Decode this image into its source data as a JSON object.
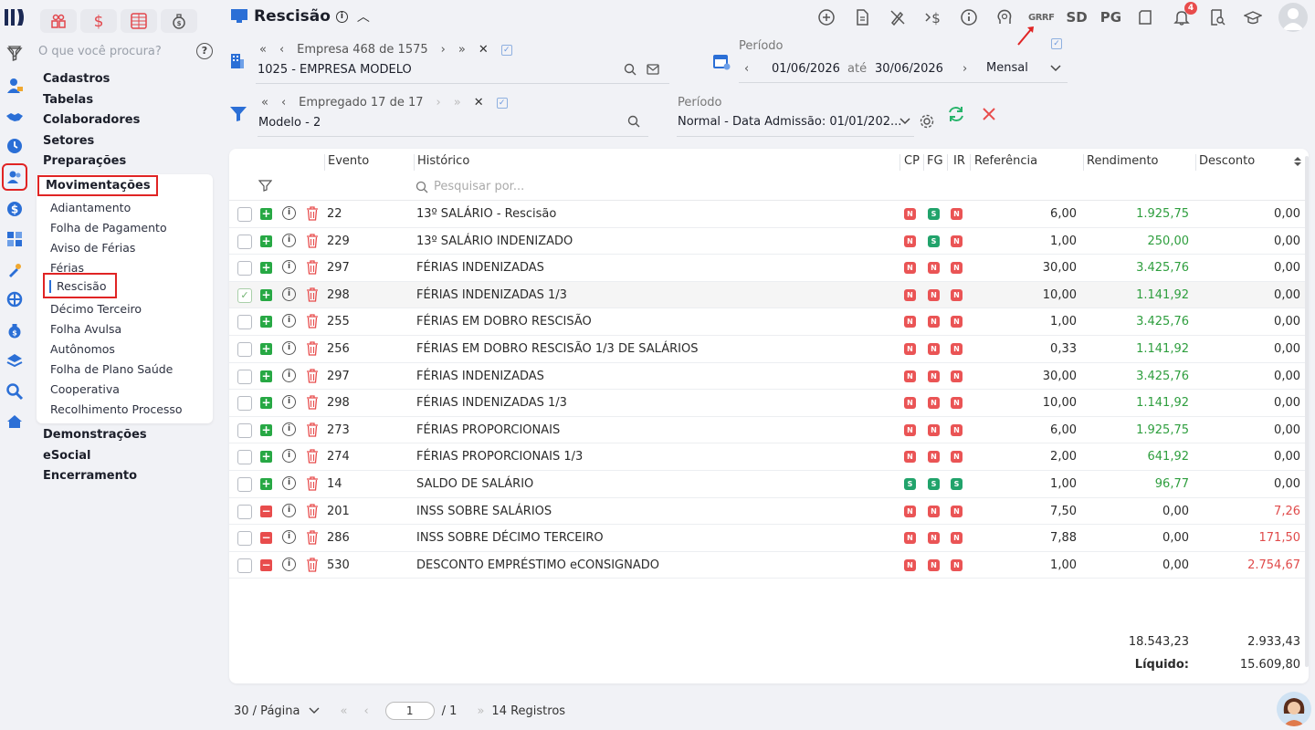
{
  "sidebar": {
    "search_placeholder": "O que você procura?",
    "help": "?",
    "groups_top": [
      "Cadastros",
      "Tabelas",
      "Colaboradores",
      "Setores",
      "Preparações"
    ],
    "panel_title": "Movimentações",
    "panel_items": [
      "Adiantamento",
      "Folha de Pagamento",
      "Aviso de Férias",
      "Férias",
      "Rescisão",
      "Décimo Terceiro",
      "Folha Avulsa",
      "Autônomos",
      "Folha de Plano Saúde",
      "Cooperativa",
      "Recolhimento Processo"
    ],
    "current_item": "Rescisão",
    "groups_bottom": [
      "Demonstrações",
      "eSocial",
      "Encerramento"
    ]
  },
  "header": {
    "title": "Rescisão",
    "topbar_text": {
      "grrf": "GRRF",
      "sd": "SD",
      "pg": "PG"
    },
    "notifications": "4"
  },
  "empresa": {
    "nav_label": "Empresa 468 de 1575",
    "value": "1025 - EMPRESA MODELO"
  },
  "periodo": {
    "label": "Período",
    "start": "01/06/2026",
    "sep": "até",
    "end": "30/06/2026",
    "mode": "Mensal"
  },
  "empregado": {
    "nav_label": "Empregado 17 de 17",
    "value": "Modelo - 2"
  },
  "periodo2": {
    "label": "Período",
    "value": "Normal - Data Admissão: 01/01/202..."
  },
  "table": {
    "headers": {
      "evento": "Evento",
      "historico": "Histórico",
      "cp": "CP",
      "fg": "FG",
      "ir": "IR",
      "referencia": "Referência",
      "rendimento": "Rendimento",
      "desconto": "Desconto"
    },
    "search_placeholder": "Pesquisar por...",
    "rows": [
      {
        "type": "plus",
        "evento": "22",
        "historico": "13º SALÁRIO - Rescisão",
        "cp": "N",
        "fg": "S",
        "ir": "N",
        "referencia": "6,00",
        "rendimento": "1.925,75",
        "desconto": "0,00"
      },
      {
        "type": "plus",
        "evento": "229",
        "historico": "13º SALÁRIO INDENIZADO",
        "cp": "N",
        "fg": "S",
        "ir": "N",
        "referencia": "1,00",
        "rendimento": "250,00",
        "desconto": "0,00"
      },
      {
        "type": "plus",
        "evento": "297",
        "historico": "FÉRIAS INDENIZADAS",
        "cp": "N",
        "fg": "N",
        "ir": "N",
        "referencia": "30,00",
        "rendimento": "3.425,76",
        "desconto": "0,00"
      },
      {
        "type": "plus",
        "evento": "298",
        "historico": "FÉRIAS INDENIZADAS 1/3",
        "cp": "N",
        "fg": "N",
        "ir": "N",
        "referencia": "10,00",
        "rendimento": "1.141,92",
        "desconto": "0,00",
        "checked": true
      },
      {
        "type": "plus",
        "evento": "255",
        "historico": "FÉRIAS EM DOBRO RESCISÃO",
        "cp": "N",
        "fg": "N",
        "ir": "N",
        "referencia": "1,00",
        "rendimento": "3.425,76",
        "desconto": "0,00"
      },
      {
        "type": "plus",
        "evento": "256",
        "historico": "FÉRIAS EM DOBRO RESCISÃO 1/3 DE SALÁRIOS",
        "cp": "N",
        "fg": "N",
        "ir": "N",
        "referencia": "0,33",
        "rendimento": "1.141,92",
        "desconto": "0,00"
      },
      {
        "type": "plus",
        "evento": "297",
        "historico": "FÉRIAS INDENIZADAS",
        "cp": "N",
        "fg": "N",
        "ir": "N",
        "referencia": "30,00",
        "rendimento": "3.425,76",
        "desconto": "0,00"
      },
      {
        "type": "plus",
        "evento": "298",
        "historico": "FÉRIAS INDENIZADAS 1/3",
        "cp": "N",
        "fg": "N",
        "ir": "N",
        "referencia": "10,00",
        "rendimento": "1.141,92",
        "desconto": "0,00"
      },
      {
        "type": "plus",
        "evento": "273",
        "historico": "FÉRIAS PROPORCIONAIS",
        "cp": "N",
        "fg": "N",
        "ir": "N",
        "referencia": "6,00",
        "rendimento": "1.925,75",
        "desconto": "0,00"
      },
      {
        "type": "plus",
        "evento": "274",
        "historico": "FÉRIAS PROPORCIONAIS 1/3",
        "cp": "N",
        "fg": "N",
        "ir": "N",
        "referencia": "2,00",
        "rendimento": "641,92",
        "desconto": "0,00"
      },
      {
        "type": "plus",
        "evento": "14",
        "historico": "SALDO DE SALÁRIO",
        "cp": "S",
        "fg": "S",
        "ir": "S",
        "referencia": "1,00",
        "rendimento": "96,77",
        "desconto": "0,00"
      },
      {
        "type": "minus",
        "evento": "201",
        "historico": "INSS SOBRE SALÁRIOS",
        "cp": "N",
        "fg": "N",
        "ir": "N",
        "referencia": "7,50",
        "rendimento": "0,00",
        "desconto": "7,26"
      },
      {
        "type": "minus",
        "evento": "286",
        "historico": "INSS SOBRE DÉCIMO TERCEIRO",
        "cp": "N",
        "fg": "N",
        "ir": "N",
        "referencia": "7,88",
        "rendimento": "0,00",
        "desconto": "171,50"
      },
      {
        "type": "minus",
        "evento": "530",
        "historico": "DESCONTO EMPRÉSTIMO eCONSIGNADO",
        "cp": "N",
        "fg": "N",
        "ir": "N",
        "referencia": "1,00",
        "rendimento": "0,00",
        "desconto": "2.754,67"
      }
    ],
    "total_rendimento": "18.543,23",
    "total_desconto": "2.933,43",
    "liquido_label": "Líquido:",
    "liquido_value": "15.609,80"
  },
  "pager": {
    "per_page": "30 / Página",
    "page": "1",
    "of": "/ 1",
    "records": "14 Registros"
  },
  "colors": {
    "accent": "#2b6fd6",
    "green": "#2e9e3e",
    "red": "#e04b4b",
    "flag_n": "#ea5455",
    "flag_s": "#21a36b"
  }
}
